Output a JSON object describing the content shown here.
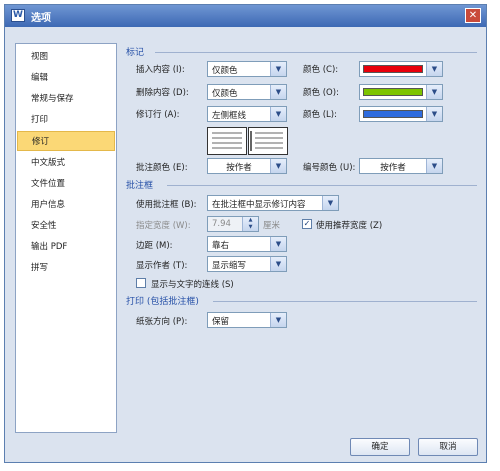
{
  "window": {
    "title": "选项",
    "app_icon_letter": "W",
    "close_glyph": "✕"
  },
  "colors": {
    "accent": "#3d69b4",
    "selected_nav": "#fbd876",
    "insert_color": "#e8000b",
    "delete_color": "#7dc400",
    "format_color": "#2f6cde"
  },
  "sidebar": {
    "items": [
      {
        "label": "视图"
      },
      {
        "label": "编辑"
      },
      {
        "label": "常规与保存"
      },
      {
        "label": "打印"
      },
      {
        "label": "修订"
      },
      {
        "label": "中文版式"
      },
      {
        "label": "文件位置"
      },
      {
        "label": "用户信息"
      },
      {
        "label": "安全性"
      },
      {
        "label": "输出 PDF"
      },
      {
        "label": "拼写"
      }
    ],
    "selected": "修订"
  },
  "marks": {
    "section_title": "标记",
    "insert_label": "插入内容 (I):",
    "insert_value": "仅颜色",
    "insert_color_label": "颜色 (C):",
    "delete_label": "删除内容 (D):",
    "delete_value": "仅颜色",
    "delete_color_label": "颜色 (O):",
    "format_label": "修订行 (A):",
    "format_value": "左侧框线",
    "format_color_label": "颜色 (L):",
    "comment_color_label": "批注颜色 (E):",
    "comment_color_value": "按作者",
    "number_color_label": "编号颜色 (U):",
    "number_color_value": "按作者"
  },
  "balloons": {
    "section_title": "批注框",
    "use_label": "使用批注框 (B):",
    "use_value": "在批注框中显示修订内容",
    "width_label": "指定宽度 (W):",
    "width_value": "7.94",
    "width_unit": "厘米",
    "recommended_label": "使用推荐宽度 (Z)",
    "recommended_checked": true,
    "margin_label": "边距 (M):",
    "margin_value": "靠右",
    "author_label": "显示作者 (T):",
    "author_value": "显示缩写",
    "lines_label": "显示与文字的连线 (S)",
    "lines_checked": false
  },
  "printing": {
    "section_title": "打印 (包括批注框)",
    "orientation_label": "纸张方向 (P):",
    "orientation_value": "保留"
  },
  "footer": {
    "ok_label": "确定",
    "cancel_label": "取消"
  },
  "icons": {
    "dropdown": "chevron-down-icon",
    "spinner": "spinner-arrows-icon",
    "check": "checkmark-icon"
  }
}
